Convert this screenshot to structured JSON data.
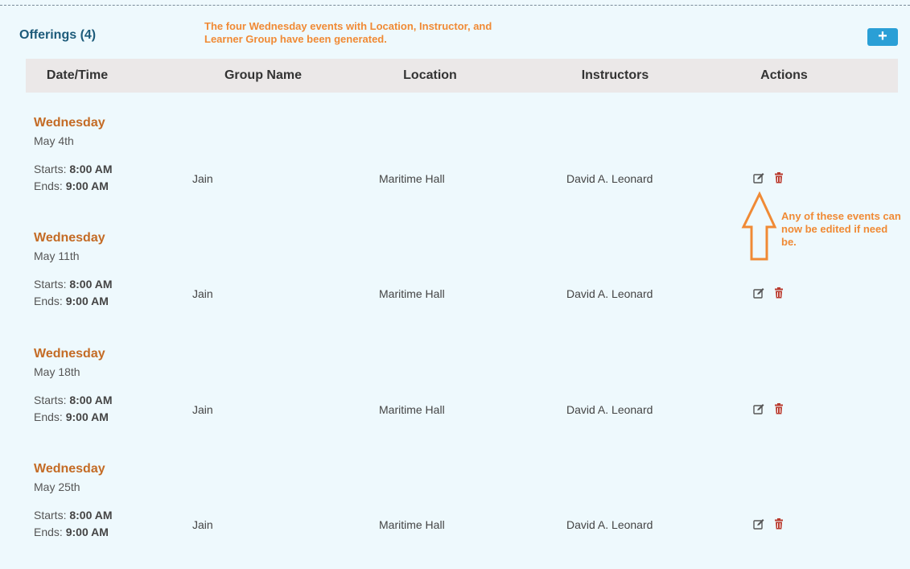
{
  "section": {
    "title": "Offerings (4)"
  },
  "annotation": {
    "top_note": "The four Wednesday events with Location, Instructor, and Learner Group have been generated.",
    "callout": "Any of these events can now be edited if need be."
  },
  "add_button": {
    "label": "+"
  },
  "table": {
    "headers": {
      "datetime": "Date/Time",
      "group": "Group Name",
      "location": "Location",
      "instructors": "Instructors",
      "actions": "Actions"
    },
    "rows": [
      {
        "day": "Wednesday",
        "date": "May 4th",
        "starts_label": "Starts:",
        "start": "8:00 AM",
        "ends_label": "Ends:",
        "end": "9:00 AM",
        "group": "Jain",
        "location": "Maritime Hall",
        "instructor": "David A. Leonard"
      },
      {
        "day": "Wednesday",
        "date": "May 11th",
        "starts_label": "Starts:",
        "start": "8:00 AM",
        "ends_label": "Ends:",
        "end": "9:00 AM",
        "group": "Jain",
        "location": "Maritime Hall",
        "instructor": "David A. Leonard"
      },
      {
        "day": "Wednesday",
        "date": "May 18th",
        "starts_label": "Starts:",
        "start": "8:00 AM",
        "ends_label": "Ends:",
        "end": "9:00 AM",
        "group": "Jain",
        "location": "Maritime Hall",
        "instructor": "David A. Leonard"
      },
      {
        "day": "Wednesday",
        "date": "May 25th",
        "starts_label": "Starts:",
        "start": "8:00 AM",
        "ends_label": "Ends:",
        "end": "9:00 AM",
        "group": "Jain",
        "location": "Maritime Hall",
        "instructor": "David A. Leonard"
      }
    ]
  },
  "icons": {
    "edit": "edit-icon",
    "delete": "trash-icon"
  },
  "colors": {
    "accent": "#2a9fd6",
    "day": "#c46b25",
    "annotation": "#f08a35",
    "delete": "#b93a2e"
  }
}
